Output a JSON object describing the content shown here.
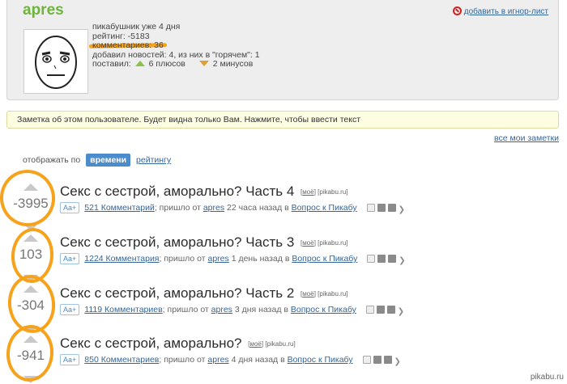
{
  "profile": {
    "username": "apres",
    "ignore_link": "добавить в игнор-лист",
    "info_line1": "пикабушник уже 4 дня",
    "info_rating": "рейтинг: -5183",
    "info_comments": "комментариев: 36",
    "info_news": "добавил новостей: 4, из них в \"горячем\": 1",
    "info_voted_prefix": "поставил:",
    "info_pluses": "6 плюсов",
    "info_minuses": "2 минусов"
  },
  "note_bar": "Заметка об этом пользователе. Будет видна только Вам. Нажмите, чтобы ввести текст",
  "all_notes_link": "все мои заметки",
  "sort": {
    "label": "отображать по",
    "active": "времени",
    "other": "рейтингу"
  },
  "posts": [
    {
      "score": "-3995",
      "title": "Секс с сестрой, аморально? Часть 4",
      "tag_mine": "моё",
      "tag_source": "[pikabu.ru]",
      "aa": "Aa+",
      "comments": "521 Комментарий",
      "came_from": "; пришло от",
      "author": "apres",
      "time": "22 часа назад в",
      "community": "Вопрос к Пикабу"
    },
    {
      "score": "103",
      "title": "Секс с сестрой, аморально? Часть 3",
      "tag_mine": "моё",
      "tag_source": "[pikabu.ru]",
      "aa": "Aa+",
      "comments": "1224 Комментария",
      "came_from": "; пришло от",
      "author": "apres",
      "time": "1 день назад в",
      "community": "Вопрос к Пикабу"
    },
    {
      "score": "-304",
      "title": "Секс с сестрой, аморально? Часть 2",
      "tag_mine": "моё",
      "tag_source": "[pikabu.ru]",
      "aa": "Aa+",
      "comments": "1119 Комментариев",
      "came_from": "; пришло от",
      "author": "apres",
      "time": "3 дня назад в",
      "community": "Вопрос к Пикабу"
    },
    {
      "score": "-941",
      "title": "Секс с сестрой, аморально?",
      "tag_mine": "моё",
      "tag_source": "[pikabu.ru]",
      "aa": "Aa+",
      "comments": "850 Комментариев",
      "came_from": "; пришло от",
      "author": "apres",
      "time": "4 дня назад в",
      "community": "Вопрос к Пикабу"
    }
  ],
  "watermark": "pikabu.ru",
  "colors": {
    "username": "#6eb43f",
    "link": "#336699",
    "highlight": "#f7a21b",
    "sort_active": "#4a8ccc"
  }
}
